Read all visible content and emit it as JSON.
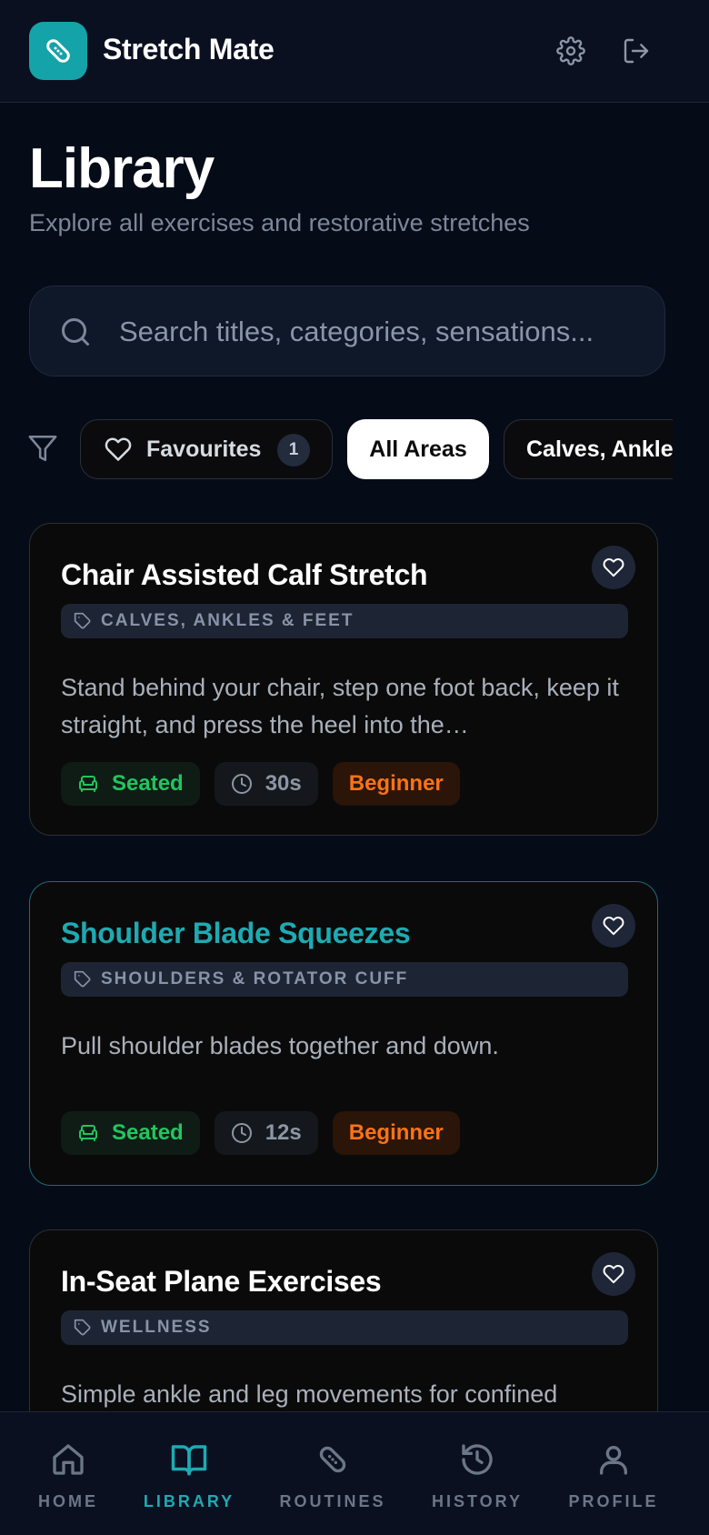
{
  "header": {
    "app_title": "Stretch Mate",
    "logo_icon": "bandage-icon",
    "settings_icon": "gear-icon",
    "logout_icon": "logout-icon"
  },
  "page": {
    "title": "Library",
    "subtitle": "Explore all exercises and restorative stretches"
  },
  "search": {
    "placeholder": "Search titles, categories, sensations...",
    "value": ""
  },
  "filters": {
    "favourites_label": "Favourites",
    "favourites_count": "1",
    "chips": [
      "All Areas",
      "Calves, Ankles & Feet"
    ],
    "selected": "All Areas"
  },
  "exercises": [
    {
      "title": "Chair Assisted Calf Stretch",
      "category": "CALVES, ANKLES & FEET",
      "description": "Stand behind your chair, step one foot back, keep it straight, and press the heel into the…",
      "position": "Seated",
      "duration": "30s",
      "level": "Beginner"
    },
    {
      "title": "Shoulder Blade Squeezes",
      "category": "SHOULDERS & ROTATOR CUFF",
      "description": "Pull shoulder blades together and down.",
      "position": "Seated",
      "duration": "12s",
      "level": "Beginner"
    },
    {
      "title": "In-Seat Plane Exercises",
      "category": "WELLNESS",
      "description": "Simple ankle and leg movements for confined"
    }
  ],
  "nav": [
    {
      "label": "HOME",
      "icon": "home-icon"
    },
    {
      "label": "LIBRARY",
      "icon": "book-icon"
    },
    {
      "label": "ROUTINES",
      "icon": "bandage-icon"
    },
    {
      "label": "HISTORY",
      "icon": "history-icon"
    },
    {
      "label": "PROFILE",
      "icon": "user-icon"
    }
  ],
  "colors": {
    "accent": "#14a3a8",
    "background": "#060b18",
    "seated": "#22c55e",
    "beginner": "#f97316"
  }
}
